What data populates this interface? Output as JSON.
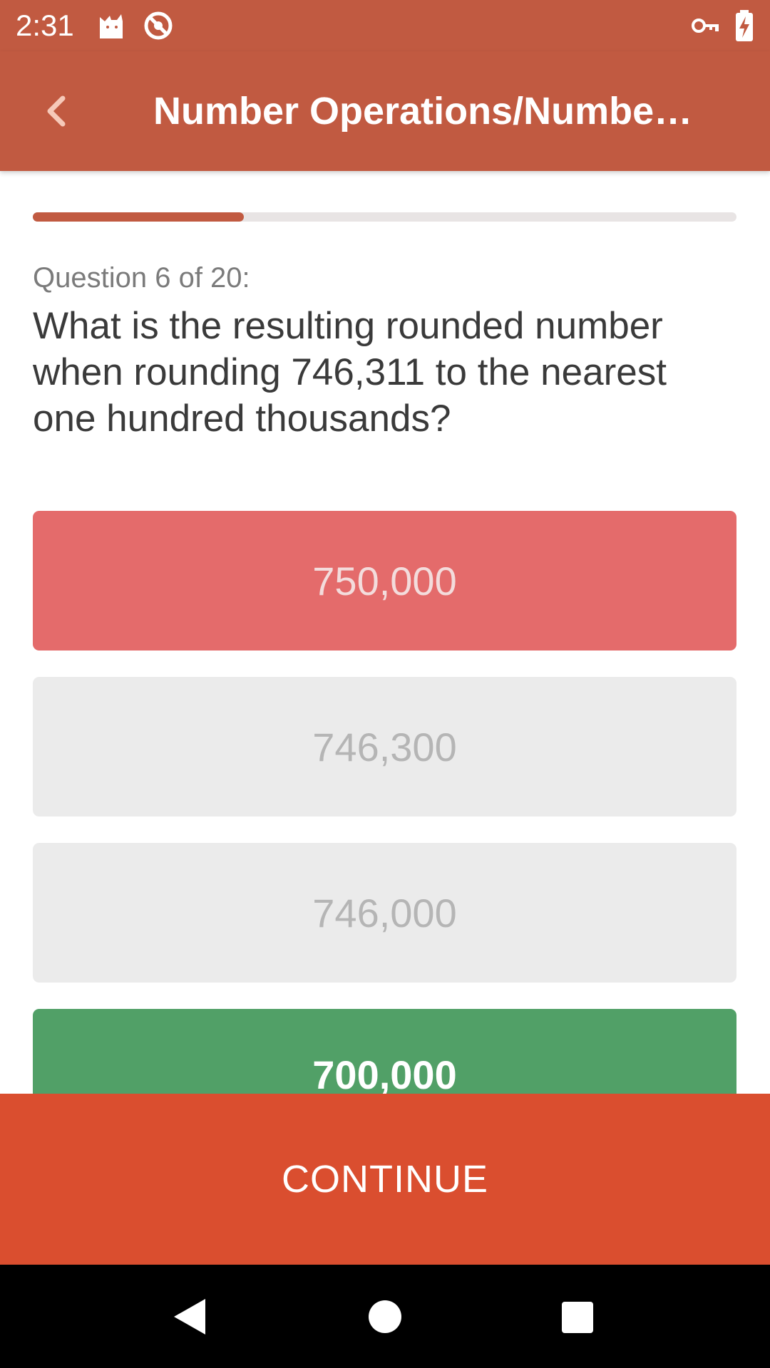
{
  "status_bar": {
    "time": "2:31",
    "icons": [
      "cat-notification-icon",
      "do-not-disturb-icon",
      "vpn-key-icon",
      "battery-charging-icon"
    ]
  },
  "app_bar": {
    "title": "Number Operations/Numbe…",
    "back_icon": "chevron-left-icon"
  },
  "progress": {
    "value": 0.3
  },
  "question": {
    "counter": "Question 6 of 20:",
    "text": "What is the resulting rounded number when rounding 746,311 to the nearest one hundred thousands?"
  },
  "answers": [
    {
      "label": "750,000",
      "state": "wrong"
    },
    {
      "label": "746,300",
      "state": "neutral"
    },
    {
      "label": "746,000",
      "state": "neutral"
    },
    {
      "label": "700,000",
      "state": "correct"
    }
  ],
  "continue_label": "CONTINUE",
  "nav_bar": {
    "icons": [
      "back-triangle-icon",
      "home-circle-icon",
      "recents-square-icon"
    ]
  },
  "colors": {
    "header": "#c15a41",
    "wrong": "#e46b6b",
    "correct": "#51a067",
    "continue": "#da4e2f"
  }
}
